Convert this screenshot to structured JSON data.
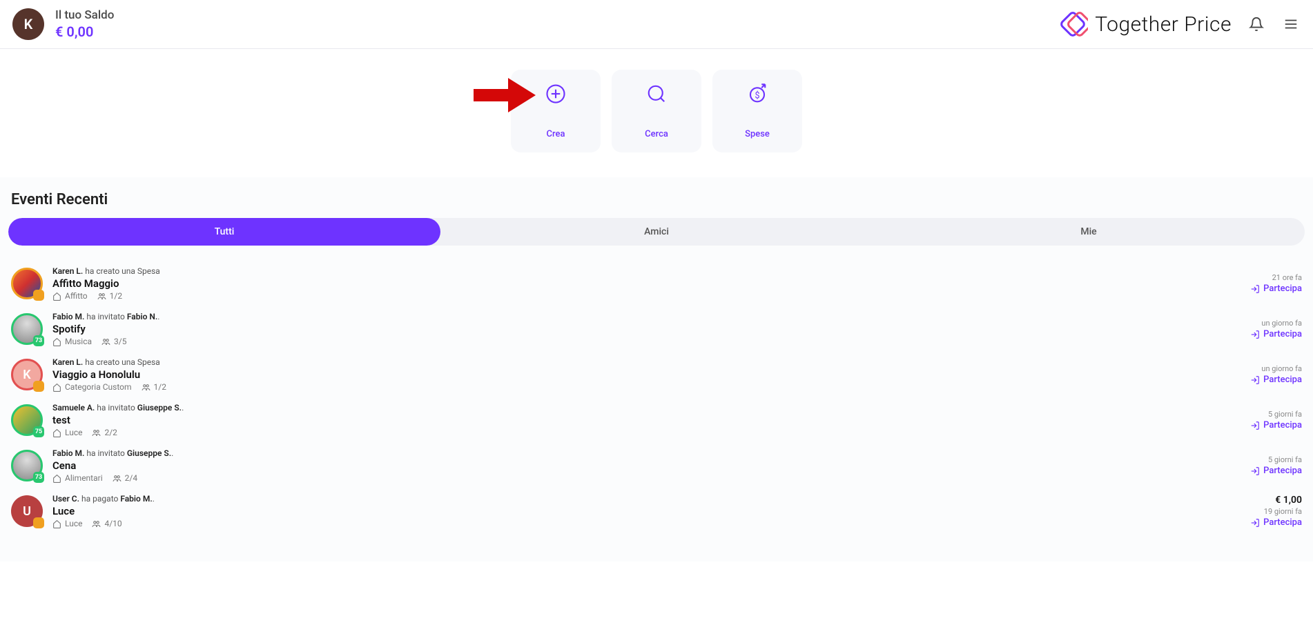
{
  "header": {
    "avatar_letter": "K",
    "avatar_bg": "#56342b",
    "saldo_label": "Il tuo Saldo",
    "saldo_amount": "€ 0,00",
    "brand": "Together Price"
  },
  "actions": {
    "crea": "Crea",
    "cerca": "Cerca",
    "spese": "Spese"
  },
  "section": {
    "title": "Eventi Recenti",
    "tabs": {
      "tutti": "Tutti",
      "amici": "Amici",
      "mie": "Mie"
    },
    "partecipa_label": "Partecipa"
  },
  "events": [
    {
      "avatar_type": "img",
      "avatar_bg": "linear-gradient(135deg,#f07030,#cf3030,#2050a0)",
      "ring": "ring-orange",
      "badge_bg": "#f0a020",
      "badge_text": "",
      "actor": "Karen L.",
      "verb": "ha creato una Spesa",
      "target": "",
      "title": "Affitto Maggio",
      "category": "Affitto",
      "people": "1/2",
      "time": "21 ore fa",
      "amount": ""
    },
    {
      "avatar_type": "img",
      "avatar_bg": "radial-gradient(circle at 50% 30%, #ddd, #888)",
      "ring": "ring-green",
      "badge_bg": "#28c76f",
      "badge_text": "73",
      "actor": "Fabio M.",
      "verb": "ha invitato",
      "target": "Fabio N.",
      "title": "Spotify",
      "category": "Musica",
      "people": "3/5",
      "time": "un giorno fa",
      "amount": ""
    },
    {
      "avatar_type": "letter",
      "avatar_letter": "K",
      "avatar_bg": "#f2a8a0",
      "ring": "ring-red",
      "badge_bg": "#f0a020",
      "badge_text": "",
      "actor": "Karen L.",
      "verb": "ha creato una Spesa",
      "target": "",
      "title": "Viaggio a Honolulu",
      "category": "Categoria Custom",
      "people": "1/2",
      "time": "un giorno fa",
      "amount": ""
    },
    {
      "avatar_type": "img",
      "avatar_bg": "linear-gradient(135deg,#f0c030,#30a060)",
      "ring": "ring-green",
      "badge_bg": "#28c76f",
      "badge_text": "75",
      "actor": "Samuele A.",
      "verb": "ha invitato",
      "target": "Giuseppe S.",
      "title": "test",
      "category": "Luce",
      "people": "2/2",
      "time": "5 giorni fa",
      "amount": ""
    },
    {
      "avatar_type": "img",
      "avatar_bg": "radial-gradient(circle at 50% 30%, #ddd, #888)",
      "ring": "ring-green",
      "badge_bg": "#28c76f",
      "badge_text": "73",
      "actor": "Fabio M.",
      "verb": "ha invitato",
      "target": "Giuseppe S.",
      "title": "Cena",
      "category": "Alimentari",
      "people": "2/4",
      "time": "5 giorni fa",
      "amount": ""
    },
    {
      "avatar_type": "letter",
      "avatar_letter": "U",
      "avatar_bg": "#b84040",
      "ring": "",
      "badge_bg": "#f0a020",
      "badge_text": "",
      "actor": "User C.",
      "verb": "ha pagato",
      "target": "Fabio M.",
      "title": "Luce",
      "category": "Luce",
      "people": "4/10",
      "time": "19 giorni fa",
      "amount": "€ 1,00"
    }
  ]
}
